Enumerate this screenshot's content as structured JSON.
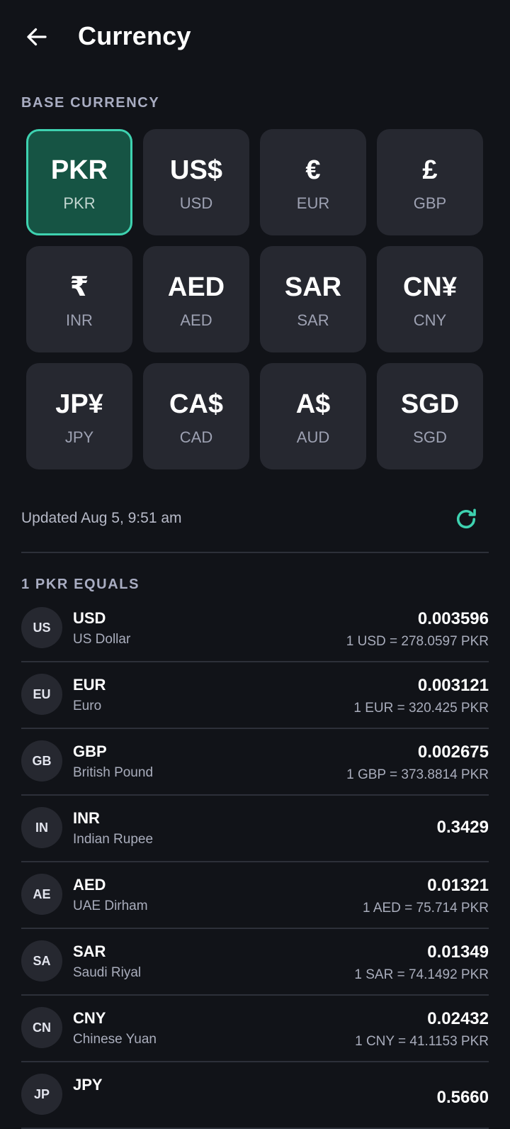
{
  "header": {
    "title": "Currency",
    "back_icon": "arrow-left-icon"
  },
  "base_section": {
    "label": "BASE CURRENCY",
    "selected": "PKR",
    "tiles": [
      {
        "symbol": "PKR",
        "code": "PKR"
      },
      {
        "symbol": "US$",
        "code": "USD"
      },
      {
        "symbol": "€",
        "code": "EUR"
      },
      {
        "symbol": "£",
        "code": "GBP"
      },
      {
        "symbol": "₹",
        "code": "INR"
      },
      {
        "symbol": "AED",
        "code": "AED"
      },
      {
        "symbol": "SAR",
        "code": "SAR"
      },
      {
        "symbol": "CN¥",
        "code": "CNY"
      },
      {
        "symbol": "JP¥",
        "code": "JPY"
      },
      {
        "symbol": "CA$",
        "code": "CAD"
      },
      {
        "symbol": "A$",
        "code": "AUD"
      },
      {
        "symbol": "SGD",
        "code": "SGD"
      }
    ]
  },
  "status": {
    "updated": "Updated Aug 5, 9:51 am",
    "refresh_icon": "refresh-icon"
  },
  "rates_section": {
    "label": "1 PKR EQUALS",
    "rows": [
      {
        "flag": "US",
        "code": "USD",
        "name": "US Dollar",
        "value": "0.003596",
        "inverse": "1 USD = 278.0597 PKR"
      },
      {
        "flag": "EU",
        "code": "EUR",
        "name": "Euro",
        "value": "0.003121",
        "inverse": "1 EUR = 320.425 PKR"
      },
      {
        "flag": "GB",
        "code": "GBP",
        "name": "British Pound",
        "value": "0.002675",
        "inverse": "1 GBP = 373.8814 PKR"
      },
      {
        "flag": "IN",
        "code": "INR",
        "name": "Indian Rupee",
        "value": "0.3429",
        "inverse": ""
      },
      {
        "flag": "AE",
        "code": "AED",
        "name": "UAE Dirham",
        "value": "0.01321",
        "inverse": "1 AED = 75.714 PKR"
      },
      {
        "flag": "SA",
        "code": "SAR",
        "name": "Saudi Riyal",
        "value": "0.01349",
        "inverse": "1 SAR = 74.1492 PKR"
      },
      {
        "flag": "CN",
        "code": "CNY",
        "name": "Chinese Yuan",
        "value": "0.02432",
        "inverse": "1 CNY = 41.1153 PKR"
      },
      {
        "flag": "JP",
        "code": "JPY",
        "name": "",
        "value": "0.5660",
        "inverse": ""
      }
    ]
  },
  "colors": {
    "background": "#111318",
    "tile": "#262830",
    "selected_tile": "#165444",
    "accent": "#3ed2b0",
    "muted_text": "#a9adbc"
  }
}
